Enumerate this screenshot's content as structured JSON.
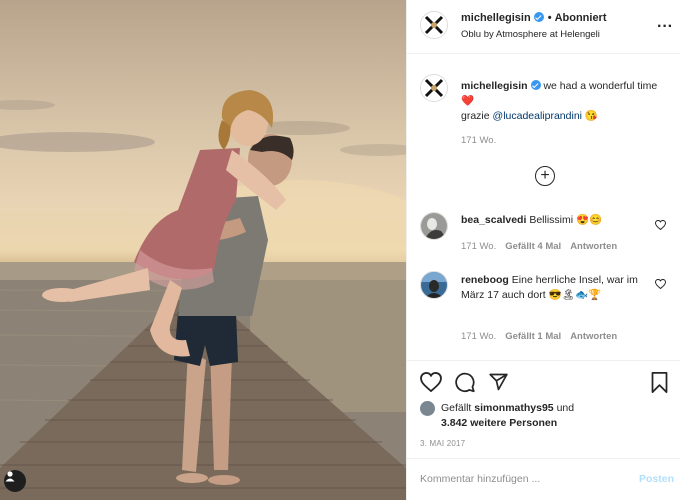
{
  "header": {
    "username": "michellegisin",
    "separator": "•",
    "follow_state": "Abonniert",
    "location": "Oblu by Atmosphere at Helengeli",
    "more_icon": "more-horizontal-icon"
  },
  "caption": {
    "username": "michellegisin",
    "text_line1": "we had a wonderful time",
    "emoji_heart": "❤️",
    "grazie": "grazie",
    "mention": "@lucadealiprandini",
    "emoji_kiss": "😘",
    "time_ago": "171 Wo."
  },
  "load_more": "+",
  "comments": [
    {
      "username": "bea_scalvedi",
      "text": "Bellissimi",
      "emojis": "😍😊",
      "time_ago": "171 Wo.",
      "likes": "Gefällt 4 Mal",
      "reply": "Antworten"
    },
    {
      "username": "reneboog",
      "text": "Eine herrliche Insel, war im März 17 auch dort",
      "emojis": "😎🏝🐟🏆",
      "time_ago": "171 Wo.",
      "likes": "Gefällt 1 Mal",
      "reply": "Antworten"
    }
  ],
  "actions": {
    "like_icon": "heart-outline-icon",
    "comment_icon": "comment-bubble-icon",
    "share_icon": "paper-plane-icon",
    "save_icon": "bookmark-icon"
  },
  "likes": {
    "prefix": "Gefällt",
    "liker": "simonmathys95",
    "conjunction": "und",
    "others": "3.842 weitere Personen"
  },
  "post_date": "3. MAI 2017",
  "comment_box": {
    "placeholder": "Kommentar hinzufügen ...",
    "post_label": "Posten"
  },
  "colors": {
    "accent_blue": "#3897f0",
    "post_button_disabled": "#b2dffc",
    "text_primary": "#262626",
    "text_secondary": "#8e8e8e"
  }
}
